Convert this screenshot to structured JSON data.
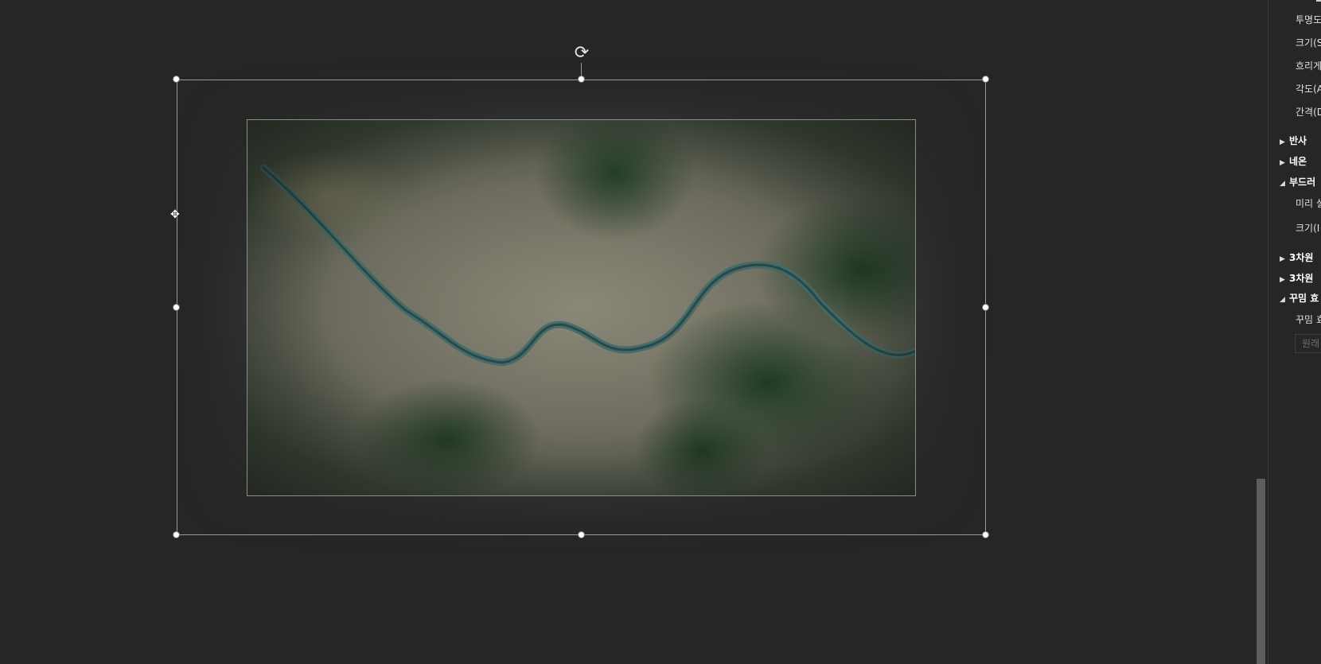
{
  "canvas": {
    "picture": {
      "name": "seoul-han-river-satellite-image"
    }
  },
  "format_panel": {
    "shadow_props": [
      {
        "label": "투명도"
      },
      {
        "label": "크기(S"
      },
      {
        "label": "흐리게"
      },
      {
        "label": "각도(A"
      },
      {
        "label": "간격(D"
      }
    ],
    "sections": [
      {
        "label": "반사",
        "expanded": false
      },
      {
        "label": "네온",
        "expanded": false
      },
      {
        "label": "부드러",
        "expanded": true
      },
      {
        "label": "3차원",
        "expanded": false
      },
      {
        "label": "3차원",
        "expanded": false
      },
      {
        "label": "꾸밈 효",
        "expanded": true
      }
    ],
    "soft_edges": {
      "preset_label": "미리 설",
      "size_label": "크기(I"
    },
    "artistic": {
      "label": "꾸밈 효",
      "reset_label": "원래"
    }
  },
  "colors": {
    "background": "#262626",
    "panel_text": "#e2e2e2",
    "river": "#3f6a6a"
  }
}
